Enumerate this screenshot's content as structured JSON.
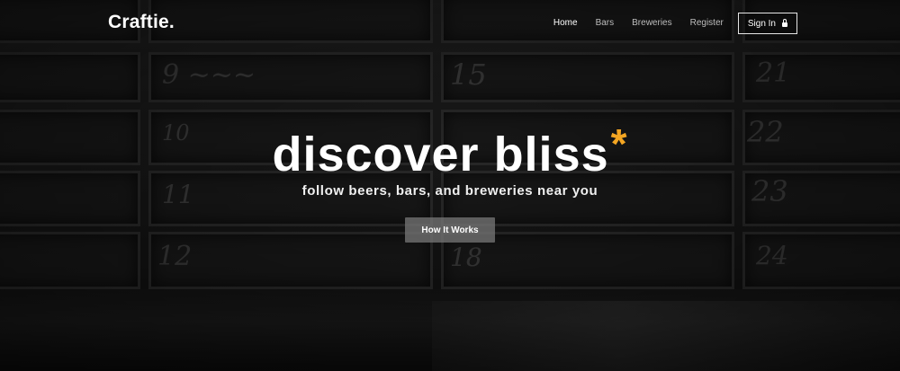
{
  "brand": {
    "logo": "Craftie."
  },
  "nav": {
    "items": [
      "Home",
      "Bars",
      "Breweries",
      "Register"
    ],
    "signin_label": "Sign In"
  },
  "hero": {
    "headline": "discover bliss",
    "headline_mark": "*",
    "tagline": "follow beers, bars, and breweries near you",
    "cta_label": "How It Works"
  },
  "colors": {
    "accent": "#f4a623",
    "text": "#ffffff"
  },
  "icons": [
    "lock-icon"
  ]
}
